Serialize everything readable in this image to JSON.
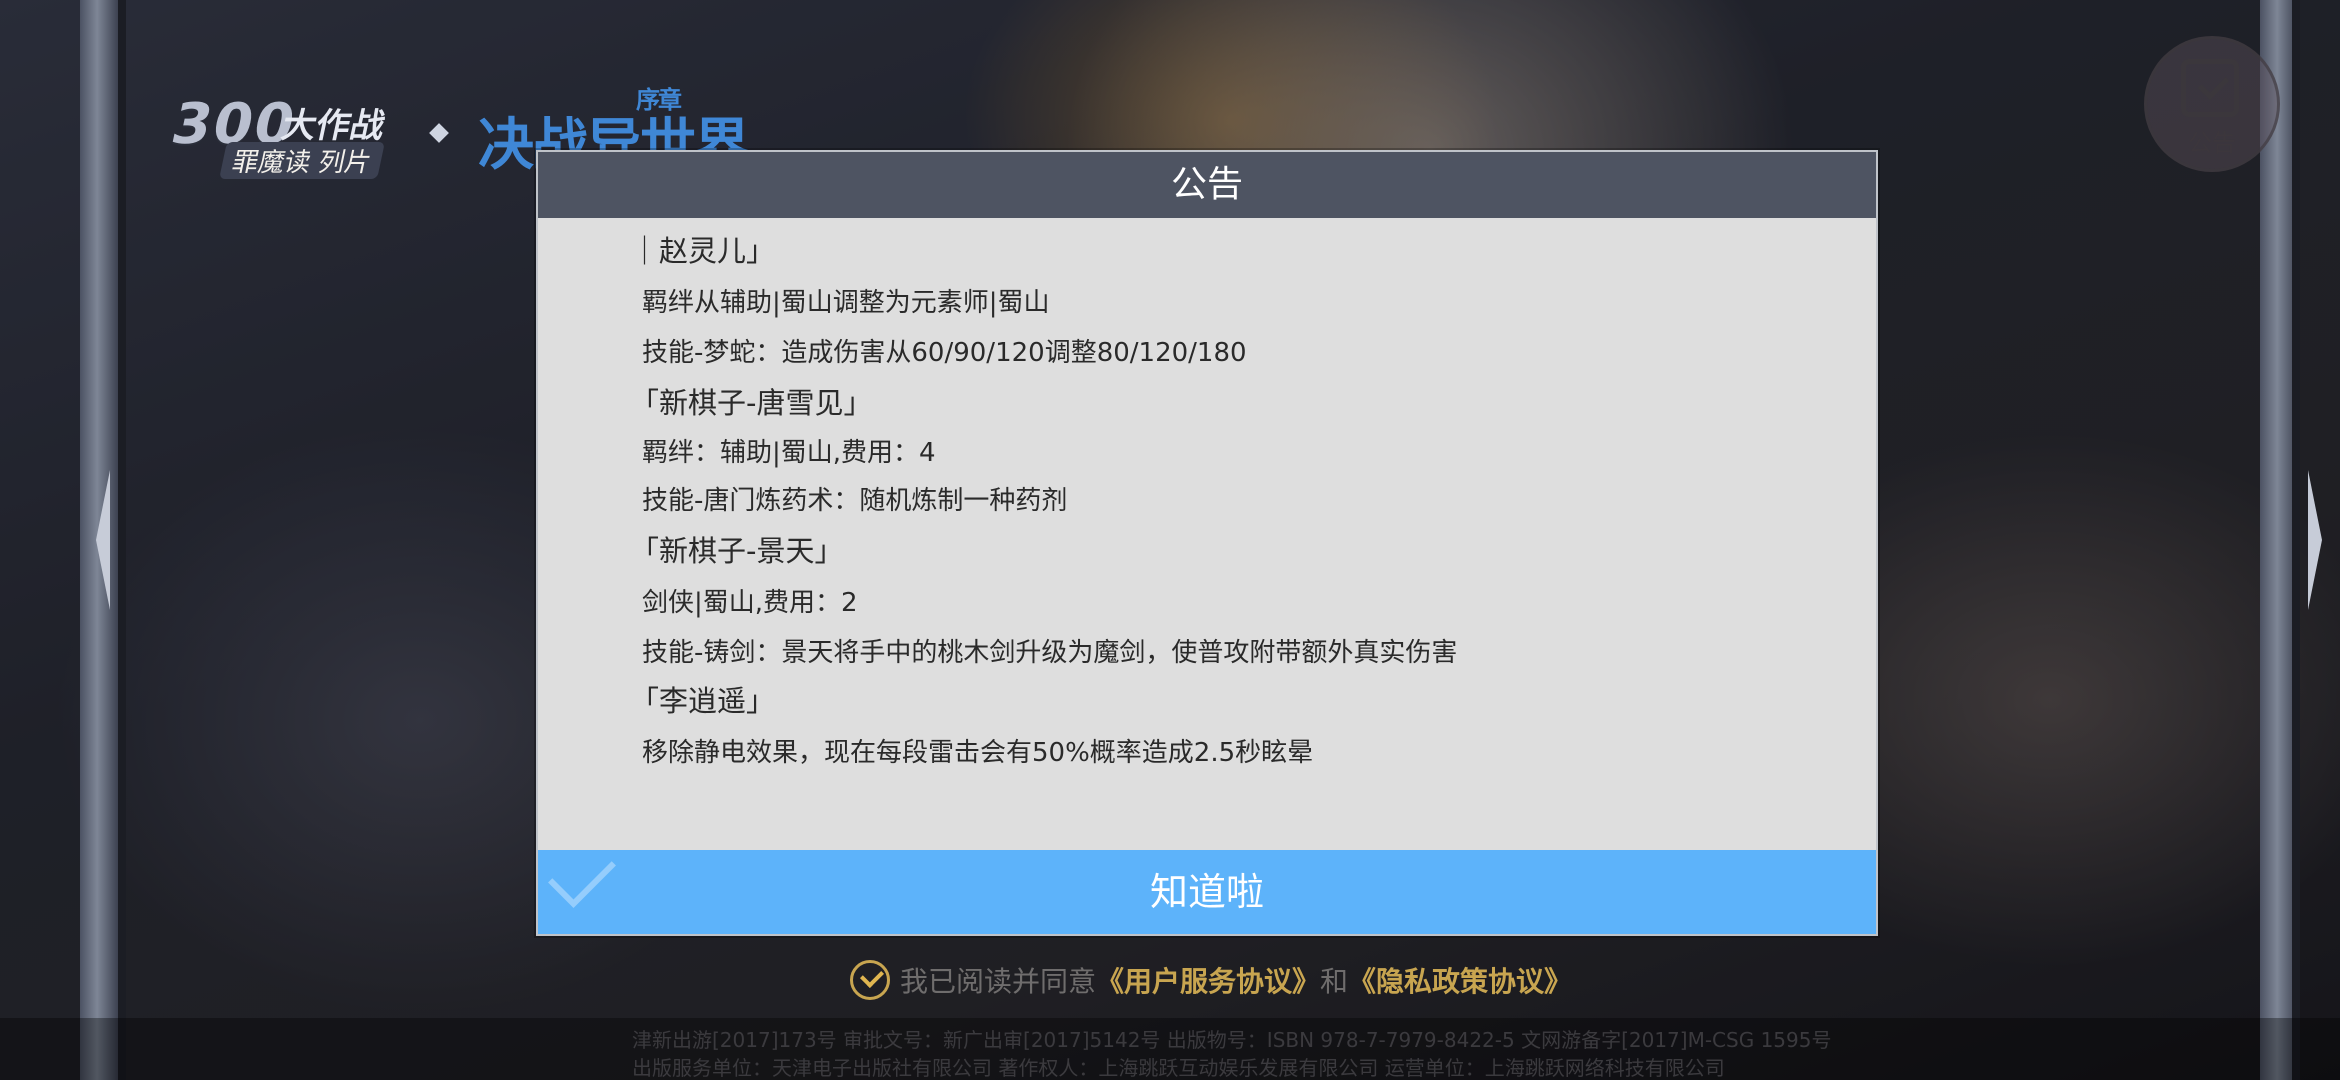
{
  "logos": {
    "game_logo_main": "300",
    "game_logo_tag": "大作战",
    "game_logo_sub": "罪魔读 列片",
    "collab_logo_main": "决战异世界",
    "collab_logo_tag": "序章"
  },
  "notice_button": {
    "label": "公告",
    "icon": "clipboard-check-icon"
  },
  "modal": {
    "title": "公告",
    "lines": [
      {
        "kind": "head",
        "text": "｜赵灵儿」"
      },
      {
        "kind": "item",
        "text": "羁绊从辅助|蜀山调整为元素师|蜀山"
      },
      {
        "kind": "item",
        "text": "技能-梦蛇：造成伤害从60/90/120调整80/120/180"
      },
      {
        "kind": "head",
        "text": "「新棋子-唐雪见」"
      },
      {
        "kind": "item",
        "text": "羁绊：辅助|蜀山,费用：4"
      },
      {
        "kind": "item",
        "text": "技能-唐门炼药术：随机炼制一种药剂"
      },
      {
        "kind": "head",
        "text": "「新棋子-景天」"
      },
      {
        "kind": "item",
        "text": "剑侠|蜀山,费用：2"
      },
      {
        "kind": "item",
        "text": "技能-铸剑：景天将手中的桃木剑升级为魔剑，使普攻附带额外真实伤害"
      },
      {
        "kind": "head",
        "text": "「李逍遥」"
      },
      {
        "kind": "item",
        "text": "移除静电效果，现在每段雷击会有50%概率造成2.5秒眩晕"
      }
    ],
    "confirm_label": "知道啦"
  },
  "agreement": {
    "checked": true,
    "prefix": "我已阅读并同意",
    "user_agreement": "《用户服务协议》",
    "and": "和",
    "privacy_policy": "《隐私政策协议》"
  },
  "license": {
    "line1": "津新出游[2017]173号 审批文号：新广出审[2017]5142号 出版物号：ISBN 978-7-7979-8422-5 文网游备字[2017]M-CSG 1595号",
    "line2": "出版服务单位：天津电子出版社有限公司 著作权人：上海跳跃互动娱乐发展有限公司 运营单位：上海跳跃网络科技有限公司"
  },
  "colors": {
    "modal_header": "#4e5462",
    "modal_body": "#dedede",
    "confirm_button": "#5db3fa",
    "agree_link": "#c8a550"
  }
}
